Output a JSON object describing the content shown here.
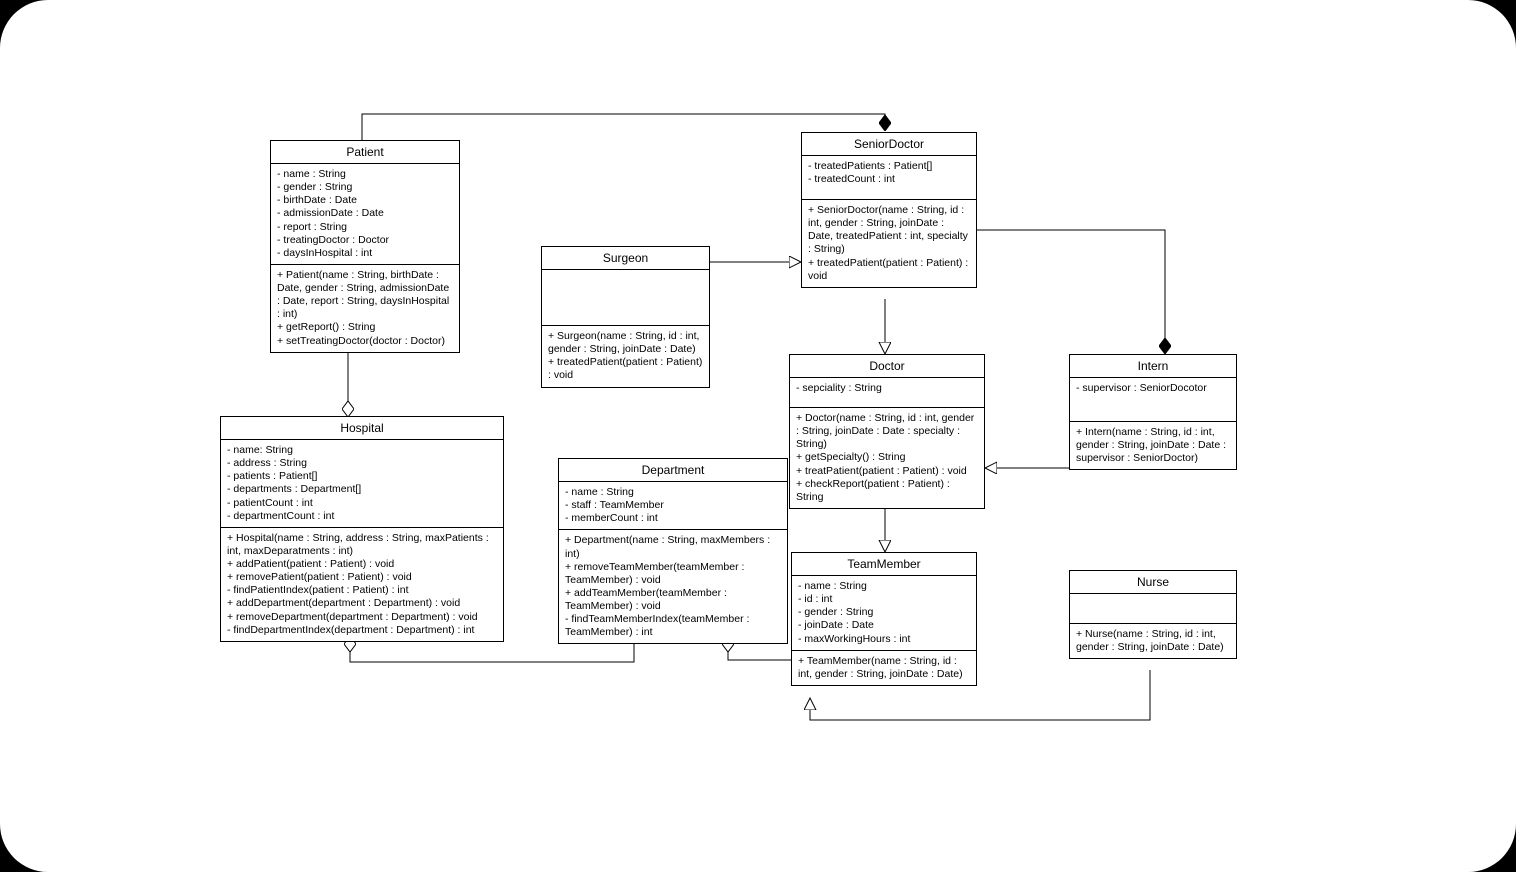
{
  "chart_data": {
    "type": "uml-class",
    "classes": {
      "Patient": {
        "title": "Patient",
        "attrs": "- name : String\n- gender : String\n- birthDate : Date\n- admissionDate : Date\n- report : String\n- treatingDoctor : Doctor\n- daysInHospital : int",
        "ops": "+ Patient(name : String, birthDate : Date, gender : String, admissionDate : Date, report : String, daysInHospital : int)\n+ getReport() : String\n+ setTreatingDoctor(doctor : Doctor)"
      },
      "Hospital": {
        "title": "Hospital",
        "attrs": "- name: String\n- address : String\n- patients : Patient[]\n- departments : Department[]\n- patientCount : int\n- departmentCount : int",
        "ops": "+ Hospital(name : String, address : String, maxPatients : int, maxDeparatments : int)\n+ addPatient(patient : Patient) : void\n+ removePatient(patient : Patient) : void\n- findPatientIndex(patient : Patient) : int\n+ addDepartment(department : Department) : void\n+ removeDepartment(department : Department) : void\n- findDepartmentIndex(department : Department) : int"
      },
      "Surgeon": {
        "title": "Surgeon",
        "attrs": " ",
        "ops": "+ Surgeon(name : String, id : int, gender : String, joinDate : Date)\n+ treatedPatient(patient : Patient) : void"
      },
      "SeniorDoctor": {
        "title": "SeniorDoctor",
        "attrs": "- treatedPatients : Patient[]\n- treatedCount : int",
        "ops": "+ SeniorDoctor(name : String, id : int, gender : String, joinDate : Date, treatedPatient : int, specialty : String)\n+ treatedPatient(patient : Patient) : void"
      },
      "Doctor": {
        "title": "Doctor",
        "attrs": "- sepciality : String",
        "ops": "+ Doctor(name : String, id : int, gender : String, joinDate : Date : specialty : String)\n+ getSpecialty() : String\n+ treatPatient(patient : Patient) : void\n+ checkReport(patient : Patient) : String"
      },
      "Department": {
        "title": "Department",
        "attrs": "- name : String\n- staff : TeamMember\n- memberCount : int",
        "ops": "+ Department(name : String, maxMembers : int)\n+ removeTeamMember(teamMember : TeamMember) : void\n+ addTeamMember(teamMember : TeamMember) : void\n- findTeamMemberIndex(teamMember : TeamMember) : int"
      },
      "TeamMember": {
        "title": "TeamMember",
        "attrs": "- name : String\n- id : int\n- gender : String\n- joinDate : Date\n- maxWorkingHours : int",
        "ops": "+ TeamMember(name : String, id : int, gender : String, joinDate : Date)"
      },
      "Intern": {
        "title": "Intern",
        "attrs": "- supervisor : SeniorDocotor",
        "ops": "+ Intern(name : String, id : int, gender : String, joinDate : Date : supervisor : SeniorDoctor)"
      },
      "Nurse": {
        "title": "Nurse",
        "attrs": " ",
        "ops": "+ Nurse(name : String, id : int, gender : String, joinDate : Date)"
      }
    },
    "relationships": [
      {
        "from": "Hospital",
        "to": "Patient",
        "type": "aggregation"
      },
      {
        "from": "Hospital",
        "to": "Department",
        "type": "aggregation"
      },
      {
        "from": "Department",
        "to": "TeamMember",
        "type": "aggregation"
      },
      {
        "from": "SeniorDoctor",
        "to": "Patient",
        "type": "composition"
      },
      {
        "from": "Intern",
        "to": "SeniorDoctor",
        "type": "composition"
      },
      {
        "from": "Surgeon",
        "to": "SeniorDoctor",
        "type": "generalization"
      },
      {
        "from": "SeniorDoctor",
        "to": "Doctor",
        "type": "generalization"
      },
      {
        "from": "Intern",
        "to": "Doctor",
        "type": "generalization"
      },
      {
        "from": "Doctor",
        "to": "TeamMember",
        "type": "generalization"
      },
      {
        "from": "Nurse",
        "to": "TeamMember",
        "type": "generalization"
      }
    ]
  }
}
